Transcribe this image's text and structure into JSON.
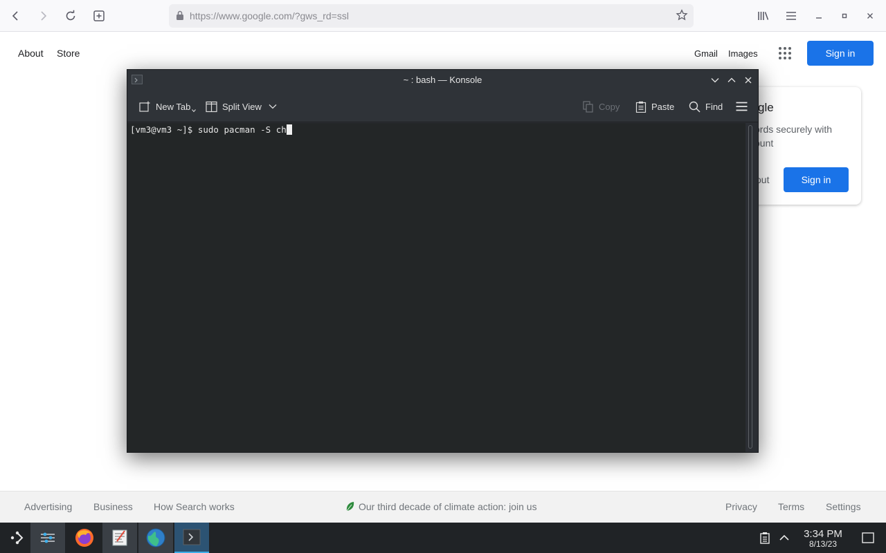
{
  "browser": {
    "url": "https://www.google.com/?gws_rd=ssl",
    "icons": [
      "back-icon",
      "forward-icon",
      "reload-icon",
      "new-tab-icon",
      "lock-icon",
      "bookmark-star-icon",
      "library-icon",
      "menu-icon",
      "minimize-icon",
      "maximize-icon",
      "close-icon"
    ]
  },
  "google": {
    "top_left_links": [
      "About",
      "Store"
    ],
    "top_right_links": [
      "Gmail",
      "Images"
    ],
    "signin_label": "Sign in",
    "popup": {
      "title": "gle",
      "description": "ords securely with\nount",
      "stay_label": "out",
      "signin_label": "Sign in"
    },
    "footer": {
      "left_links": [
        "Advertising",
        "Business",
        "How Search works"
      ],
      "climate_text": "Our third decade of climate action: join us",
      "right_links": [
        "Privacy",
        "Terms",
        "Settings"
      ]
    },
    "brand_blue": "#1a73e8"
  },
  "konsole": {
    "title": "~ : bash — Konsole",
    "toolbar": {
      "new_tab": "New Tab",
      "split_view": "Split View",
      "copy": "Copy",
      "paste": "Paste",
      "find": "Find"
    },
    "terminal": {
      "prompt": "[vm3@vm3 ~]$ ",
      "command": "sudo pacman -S ch"
    }
  },
  "taskbar": {
    "apps": [
      "application-launcher-icon",
      "system-settings-icon",
      "firefox-icon",
      "text-editor-icon",
      "web-browser-icon",
      "konsole-icon"
    ],
    "time": "3:34 PM",
    "date": "8/13/23"
  }
}
